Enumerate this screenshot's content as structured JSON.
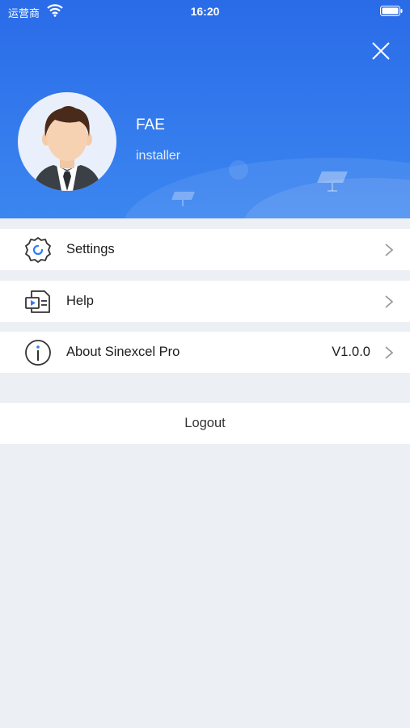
{
  "status_bar": {
    "carrier": "运营商",
    "time": "16:20"
  },
  "profile": {
    "name": "FAE",
    "role": "installer"
  },
  "menu": [
    {
      "label": "Settings",
      "icon": "settings-icon",
      "value": ""
    },
    {
      "label": "Help",
      "icon": "help-icon",
      "value": ""
    },
    {
      "label": "About Sinexcel Pro",
      "icon": "info-icon",
      "value": "V1.0.0"
    }
  ],
  "logout_label": "Logout",
  "colors": {
    "header_top": "#2a6be8",
    "header_bottom": "#3b86f0",
    "background": "#eceff3",
    "accent": "#2f7cf6"
  }
}
